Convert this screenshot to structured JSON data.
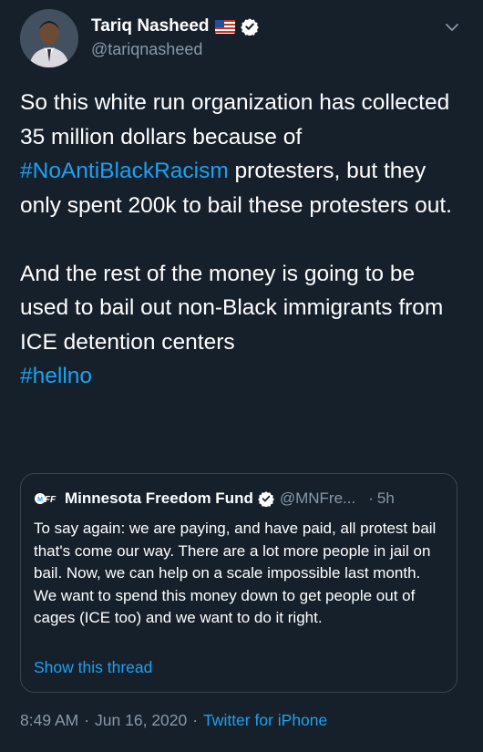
{
  "author": {
    "name": "Tariq Nasheed",
    "handle": "@tariqnasheed",
    "flag_icon": "us-flag-icon",
    "verified_icon": "verified-badge-icon"
  },
  "menu_icon": "chevron-down-icon",
  "tweet": {
    "p1_a": "So this white run organization has collected 35 million dollars because of ",
    "p1_tag": "#NoAntiBlackRacism",
    "p1_b": " protesters, but they only spent 200k to bail these protesters out.",
    "p2": "And the rest of the money is going to be used to bail out non-Black immigrants from ICE detention centers",
    "p2_tag": "#hellno"
  },
  "quoted": {
    "logo_text": "MFF",
    "name": "Minnesota Freedom Fund",
    "handle": "@MNFre...",
    "dot": "·",
    "time": "5h",
    "text": "To say again: we are paying, and have paid, all protest bail that's come our way. There are a lot more people in jail on bail. Now, we can help on a scale impossible last month. We want to spend this money down to get people out of cages (ICE too) and we want to do it right.",
    "show_thread": "Show this thread"
  },
  "meta": {
    "time": "8:49 AM",
    "sep1": "·",
    "date": "Jun 16, 2020",
    "sep2": "·",
    "app": "Twitter for iPhone"
  },
  "colors": {
    "background": "#15202b",
    "link": "#1da1f2",
    "secondary_text": "#8899a6",
    "border": "#38444d"
  }
}
